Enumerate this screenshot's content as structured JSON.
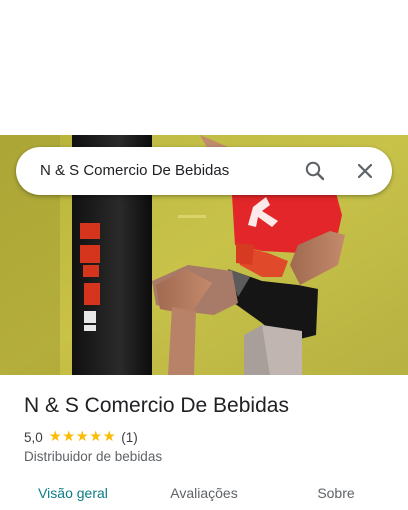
{
  "search": {
    "query": "N & S Comercio De Bebidas",
    "search_icon": "search-icon",
    "close_icon": "close-icon"
  },
  "place": {
    "name": "N & S Comercio De Bebidas",
    "rating": "5,0",
    "stars": "★★★★★",
    "rating_value": 5,
    "review_count": "(1)",
    "category": "Distribuidor de bebidas"
  },
  "tabs": [
    {
      "label": "Visão geral",
      "active": true
    },
    {
      "label": "Avaliações",
      "active": false
    },
    {
      "label": "Sobre",
      "active": false
    }
  ],
  "colors": {
    "accent": "#0b7d86",
    "star": "#fbbc04"
  }
}
